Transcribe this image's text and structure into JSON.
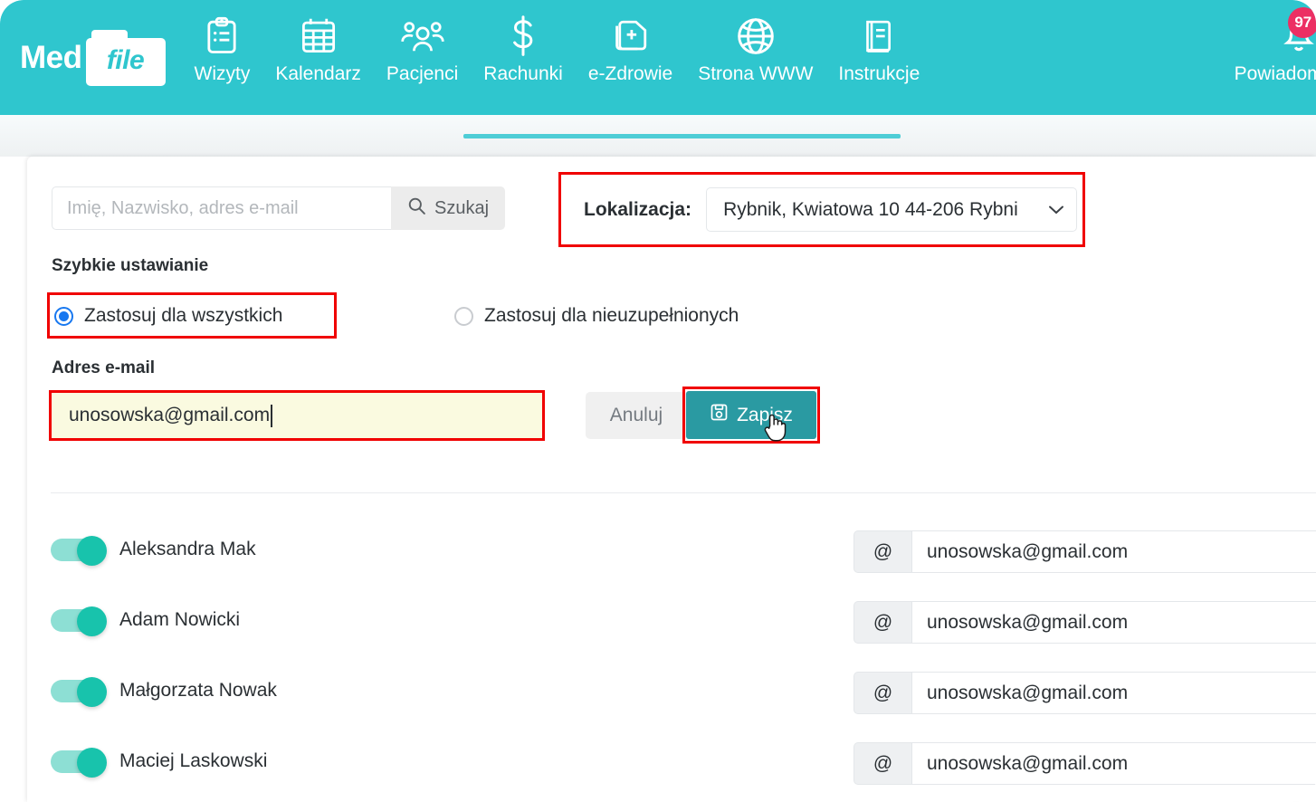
{
  "header": {
    "brand": {
      "med": "Med",
      "file": "file"
    },
    "nav": [
      {
        "label": "Wizyty",
        "icon": "clipboard-icon"
      },
      {
        "label": "Kalendarz",
        "icon": "calendar-icon"
      },
      {
        "label": "Pacjenci",
        "icon": "people-icon"
      },
      {
        "label": "Rachunki",
        "icon": "dollar-icon"
      },
      {
        "label": "e-Zdrowie",
        "icon": "medical-file-icon"
      },
      {
        "label": "Strona WWW",
        "icon": "globe-icon"
      },
      {
        "label": "Instrukcje",
        "icon": "book-icon"
      }
    ],
    "notifications": {
      "label": "Powiadomienia",
      "count": "97",
      "icon": "bell-icon"
    },
    "bg_color": "#2FC6CE",
    "badge_color": "#ec2f63"
  },
  "toolbar": {
    "search": {
      "placeholder": "Imię, Nazwisko, adres e-mail",
      "value": "",
      "button_label": "Szukaj",
      "button_icon": "search-icon"
    },
    "location": {
      "label": "Lokalizacja:",
      "value": "Rybnik, Kwiatowa 10 44-206 Rybni",
      "chevron": "⌄"
    }
  },
  "quick_settings": {
    "title": "Szybkie ustawianie",
    "options": [
      {
        "label": "Zastosuj dla wszystkich",
        "selected": true
      },
      {
        "label": "Zastosuj dla nieuzupełnionych",
        "selected": false
      }
    ],
    "email_label": "Adres e-mail",
    "email_value": "unosowska@gmail.com",
    "cancel_label": "Anuluj",
    "save_label": "Zapisz",
    "save_icon": "save-icon",
    "save_color": "#2a9aa2",
    "highlight_color": "#f00000",
    "input_fill": "#fafae0"
  },
  "patients": [
    {
      "name": "Aleksandra Mak",
      "enabled": true,
      "email": "unosowska@gmail.com",
      "prefix": "@"
    },
    {
      "name": "Adam Nowicki",
      "enabled": true,
      "email": "unosowska@gmail.com",
      "prefix": "@"
    },
    {
      "name": "Małgorzata Nowak",
      "enabled": true,
      "email": "unosowska@gmail.com",
      "prefix": "@"
    },
    {
      "name": "Maciej Laskowski",
      "enabled": true,
      "email": "unosowska@gmail.com",
      "prefix": "@"
    }
  ]
}
